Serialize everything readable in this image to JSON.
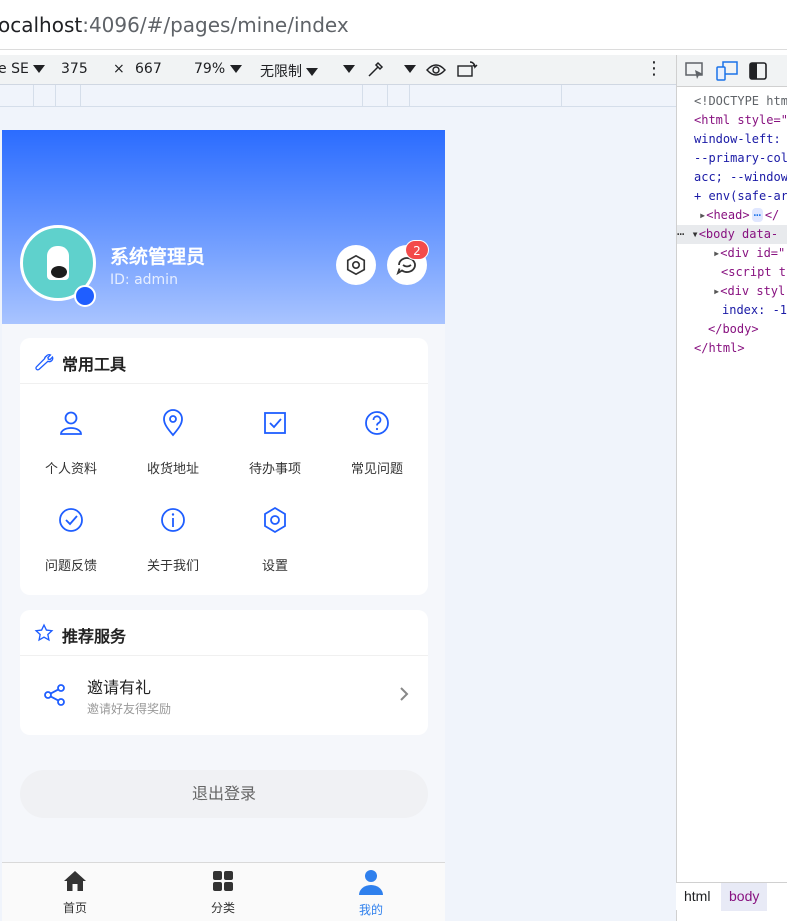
{
  "browser": {
    "url_host": "ocalhost",
    "url_rest": ":4096/#/pages/mine/index"
  },
  "device_toolbar": {
    "device": "e SE",
    "width": "375",
    "times": "×",
    "height": "667",
    "zoom": "79%",
    "throttle": "无限制",
    "more": "⋮"
  },
  "profile": {
    "name": "系统管理员",
    "id_text": "ID: admin",
    "message_badge": "2"
  },
  "tools_card": {
    "title": "常用工具",
    "items": [
      {
        "label": "个人资料",
        "icon": "user-icon"
      },
      {
        "label": "收货地址",
        "icon": "location-pin-icon"
      },
      {
        "label": "待办事项",
        "icon": "checkbox-icon"
      },
      {
        "label": "常见问题",
        "icon": "question-icon"
      },
      {
        "label": "问题反馈",
        "icon": "check-circle-icon"
      },
      {
        "label": "关于我们",
        "icon": "info-icon"
      },
      {
        "label": "设置",
        "icon": "hexagon-settings-icon"
      }
    ]
  },
  "services_card": {
    "title": "推荐服务",
    "items": [
      {
        "title": "邀请有礼",
        "subtitle": "邀请好友得奖励"
      }
    ]
  },
  "logout_label": "退出登录",
  "tabbar": [
    {
      "label": "首页",
      "icon": "home-icon",
      "active": false
    },
    {
      "label": "分类",
      "icon": "grid-icon",
      "active": false
    },
    {
      "label": "我的",
      "icon": "person-icon",
      "active": true
    }
  ],
  "colors": {
    "primary": "#2b6cff",
    "accent_icon": "#1f5eff",
    "badge": "#f34b4b",
    "tab_active": "#2f80ed"
  },
  "devtools": {
    "lines": [
      "<!DOCTYPE htm",
      "<html style=\"",
      "window-left: ",
      "--primary-col",
      "acc; --window",
      "+ env(safe-ar",
      "<head>",
      "<body data-",
      "<div id=\"",
      "<script t",
      "<div styl",
      "index: -1",
      "</body>",
      "</html>"
    ],
    "head_ellipsis": "⋯",
    "head_close": "</",
    "crumbs": [
      "html",
      "body"
    ]
  }
}
